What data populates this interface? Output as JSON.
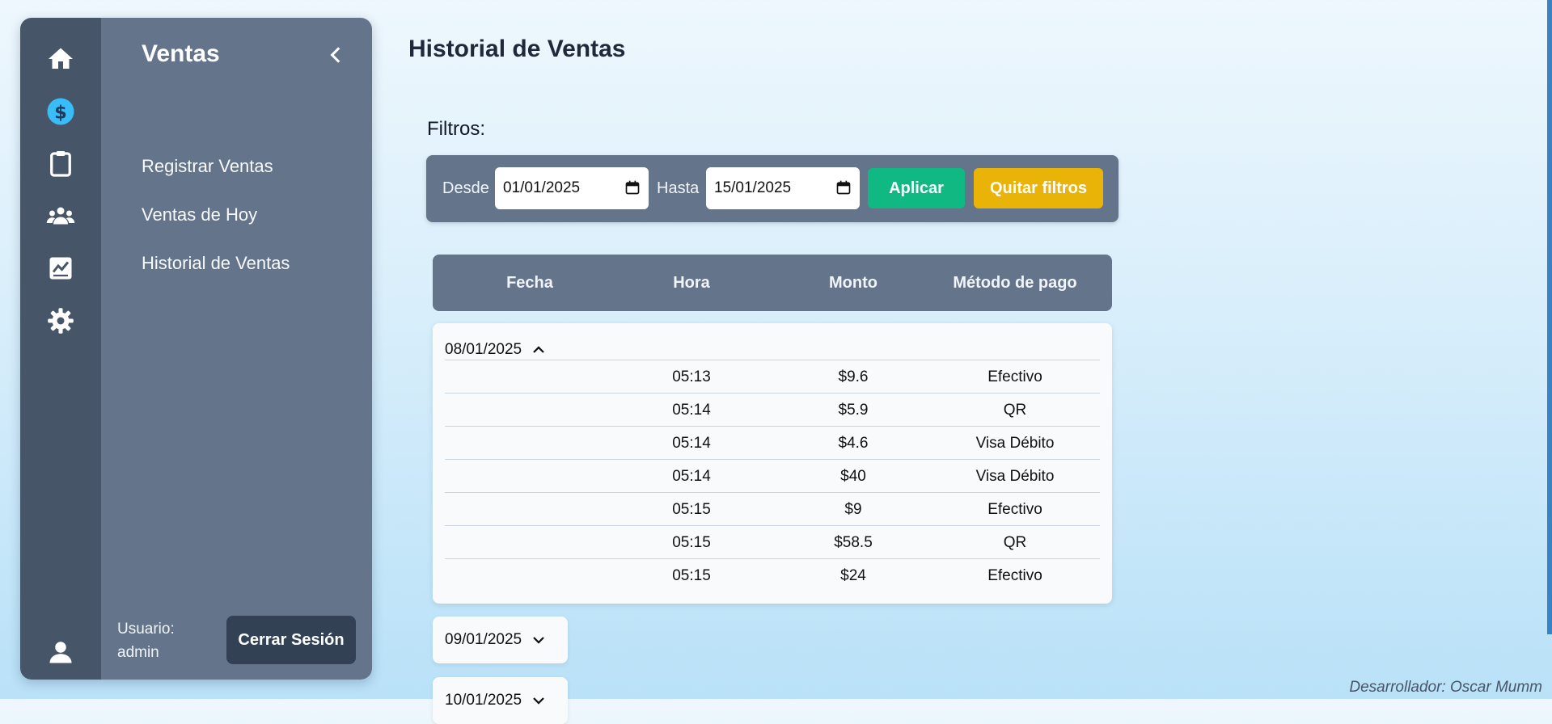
{
  "colors": {
    "rail": "#475569",
    "panel": "#64748b",
    "accent_active_icon": "#38bdf8",
    "apply": "#10b981",
    "clear": "#eab308",
    "logout": "#334155"
  },
  "rail_icons": [
    "home-icon",
    "dollar-icon",
    "clipboard-icon",
    "users-icon",
    "chart-icon",
    "gear-icon",
    "user-icon"
  ],
  "sidebar": {
    "title": "Ventas",
    "items": [
      {
        "label": "Registrar Ventas"
      },
      {
        "label": "Ventas de Hoy"
      },
      {
        "label": "Historial de Ventas"
      }
    ],
    "user_label": "Usuario:",
    "user_name": "admin",
    "logout_label": "Cerrar Sesión"
  },
  "page": {
    "title": "Historial de Ventas",
    "filters_label": "Filtros:"
  },
  "filters": {
    "from_label": "Desde",
    "from_value": "01/01/2025",
    "to_label": "Hasta",
    "to_value": "15/01/2025",
    "apply_label": "Aplicar",
    "clear_label": "Quitar filtros"
  },
  "table": {
    "headers": [
      "Fecha",
      "Hora",
      "Monto",
      "Método de pago"
    ],
    "groups": [
      {
        "date": "08/01/2025",
        "expanded": true,
        "rows": [
          {
            "hora": "05:13",
            "monto": "$9.6",
            "metodo": "Efectivo"
          },
          {
            "hora": "05:14",
            "monto": "$5.9",
            "metodo": "QR"
          },
          {
            "hora": "05:14",
            "monto": "$4.6",
            "metodo": "Visa Débito"
          },
          {
            "hora": "05:14",
            "monto": "$40",
            "metodo": "Visa Débito"
          },
          {
            "hora": "05:15",
            "monto": "$9",
            "metodo": "Efectivo"
          },
          {
            "hora": "05:15",
            "monto": "$58.5",
            "metodo": "QR"
          },
          {
            "hora": "05:15",
            "monto": "$24",
            "metodo": "Efectivo"
          }
        ]
      },
      {
        "date": "09/01/2025",
        "expanded": false
      },
      {
        "date": "10/01/2025",
        "expanded": false
      }
    ]
  },
  "footer": "Desarrollador: Oscar Mumm"
}
